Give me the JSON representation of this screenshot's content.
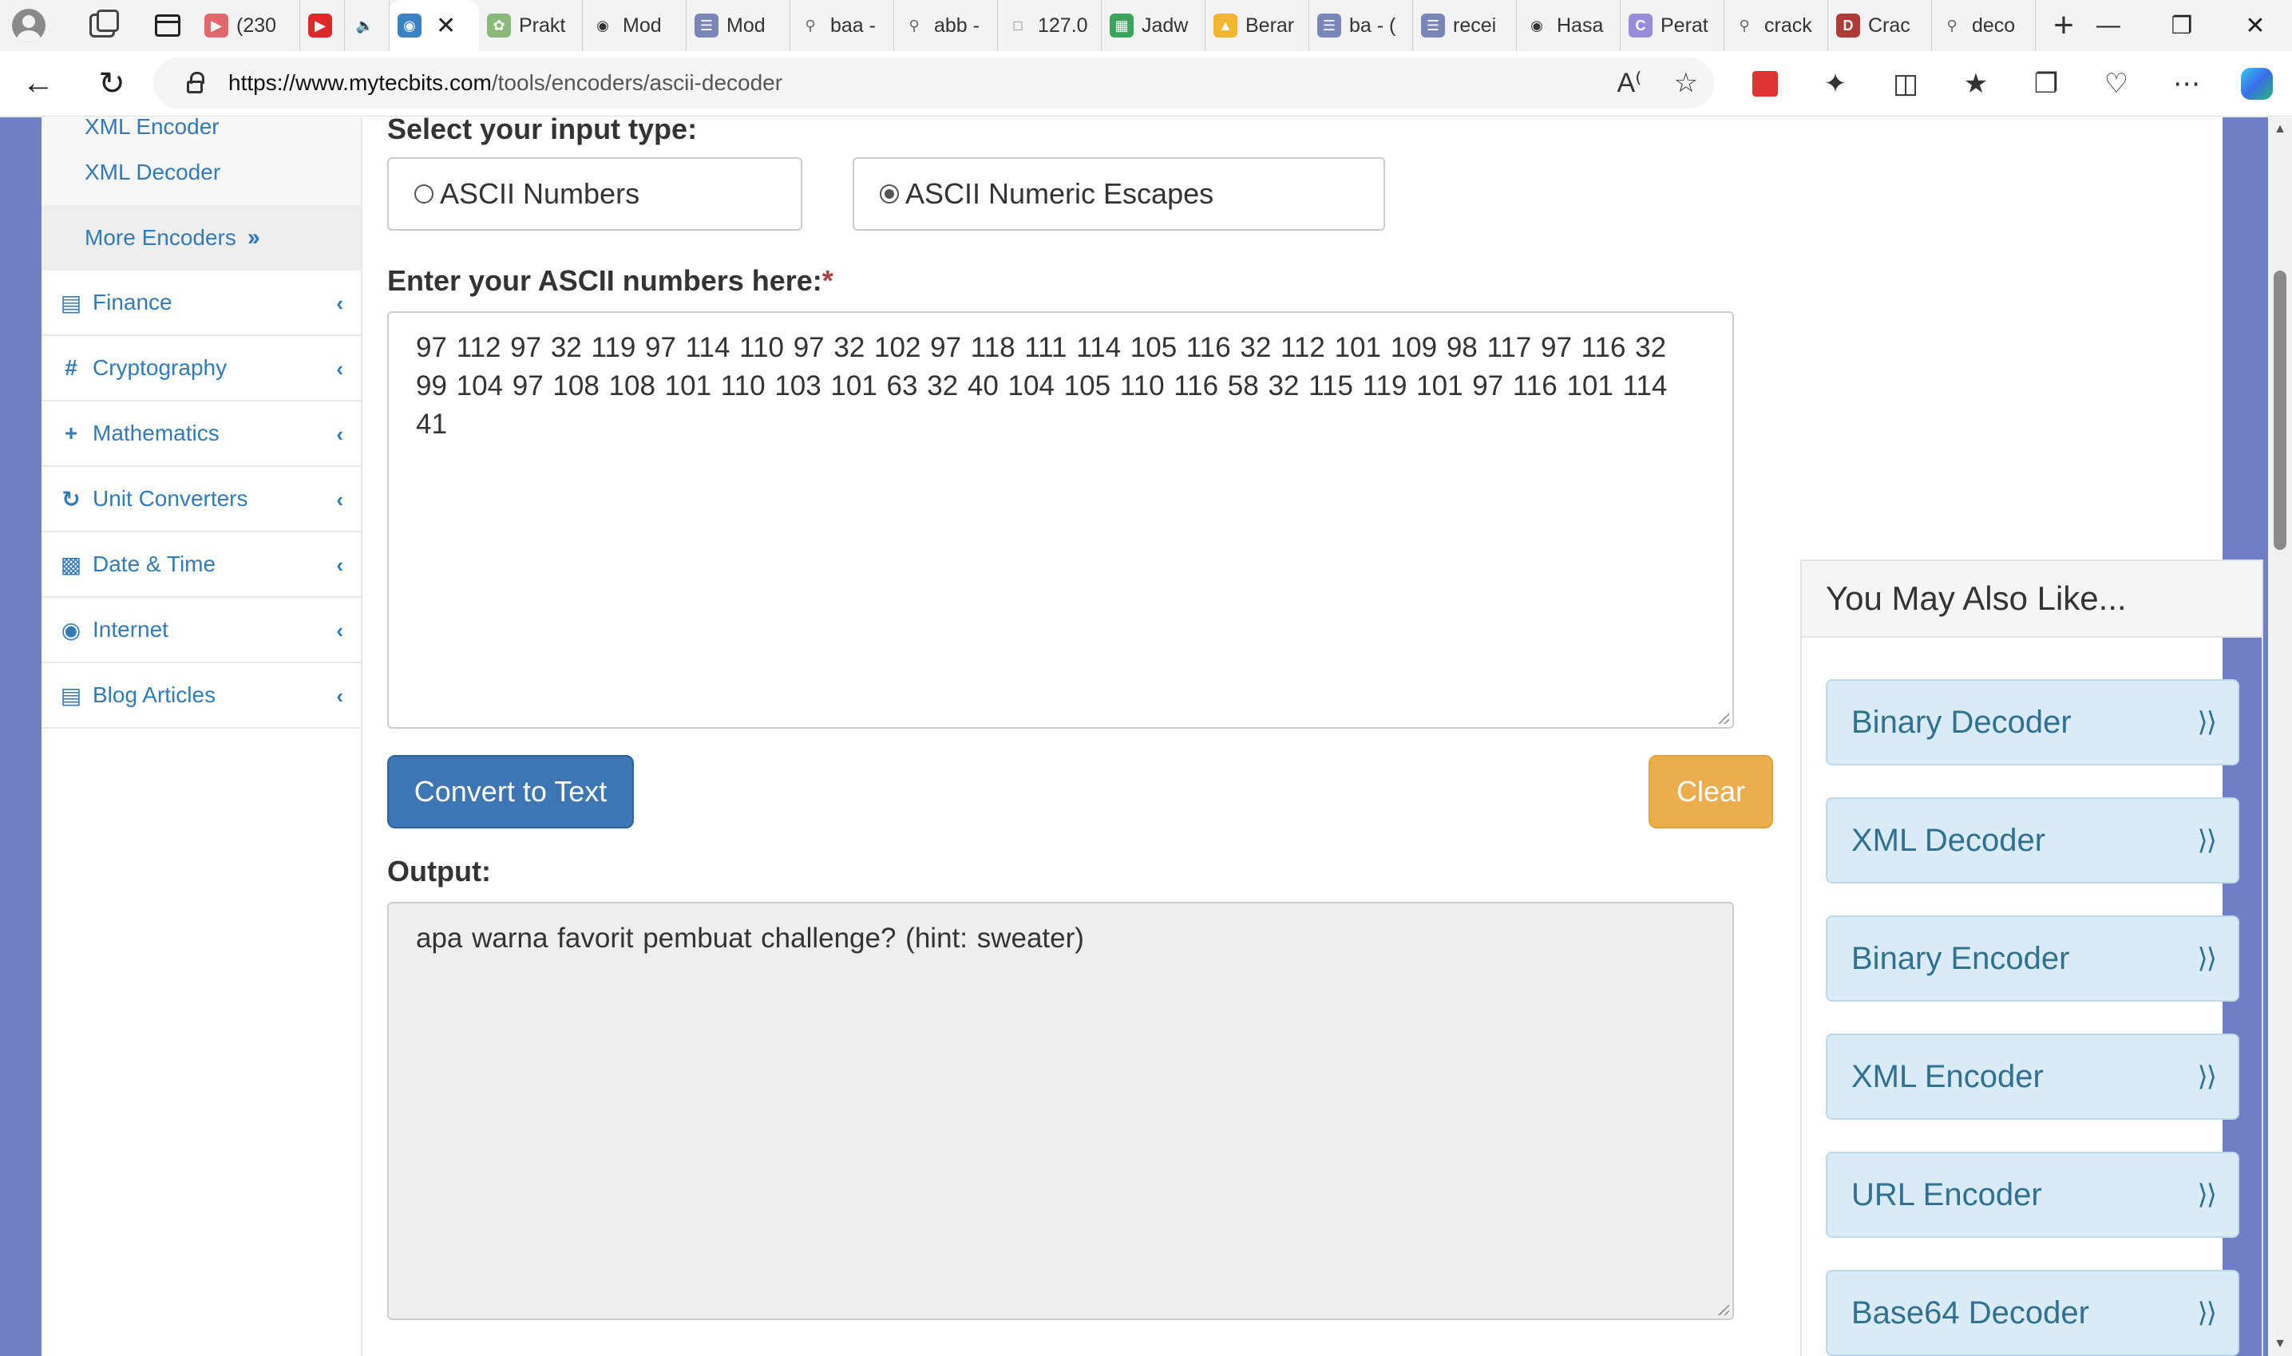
{
  "browser": {
    "tabs": [
      {
        "label": "(230",
        "favicon": "youtube-icon",
        "color": "#e0676d"
      },
      {
        "label": "",
        "favicon": "youtube-icon",
        "color": "#e02828"
      },
      {
        "label": "",
        "favicon": "sound-icon",
        "color": "#333333"
      },
      {
        "label": "",
        "favicon": "globe-icon",
        "color": "#3b82c4",
        "active": true
      },
      {
        "label": "Prakt",
        "favicon": "leaf-icon",
        "color": "#8bb87b"
      },
      {
        "label": "Mod",
        "favicon": "github-icon",
        "color": "#333333"
      },
      {
        "label": "Mod",
        "favicon": "doc-icon",
        "color": "#7a86b8"
      },
      {
        "label": "baa -",
        "favicon": "search-icon",
        "color": "#666666"
      },
      {
        "label": "abb -",
        "favicon": "search-icon",
        "color": "#666666"
      },
      {
        "label": "127.0",
        "favicon": "page-icon",
        "color": "#777777"
      },
      {
        "label": "Jadw",
        "favicon": "sheet-icon",
        "color": "#3aa35c"
      },
      {
        "label": "Berar",
        "favicon": "drive-icon",
        "color": "#f2b632"
      },
      {
        "label": "ba - (",
        "favicon": "doc-icon",
        "color": "#7a86b8"
      },
      {
        "label": "recei",
        "favicon": "doc-icon",
        "color": "#7a86b8"
      },
      {
        "label": "Hasa",
        "favicon": "github-icon",
        "color": "#333333"
      },
      {
        "label": "Perat",
        "favicon": "c-icon",
        "color": "#9a8bd6"
      },
      {
        "label": "crack",
        "favicon": "search-icon",
        "color": "#666666"
      },
      {
        "label": "Crac",
        "favicon": "d-icon",
        "color": "#b03a3a"
      },
      {
        "label": "deco",
        "favicon": "search-icon",
        "color": "#666666"
      }
    ],
    "url_host": "https://www.mytecbits.com",
    "url_path": "/tools/encoders/ascii-decoder"
  },
  "sidebar": {
    "sub_items": [
      "XML Encoder",
      "XML Decoder"
    ],
    "more_label": "More Encoders",
    "items": [
      {
        "label": "Finance",
        "icon": "money-icon"
      },
      {
        "label": "Cryptography",
        "icon": "hash-icon"
      },
      {
        "label": "Mathematics",
        "icon": "plus-icon"
      },
      {
        "label": "Unit Converters",
        "icon": "refresh-icon"
      },
      {
        "label": "Date & Time",
        "icon": "calendar-icon"
      },
      {
        "label": "Internet",
        "icon": "globe-icon"
      },
      {
        "label": "Blog Articles",
        "icon": "book-icon"
      }
    ]
  },
  "main": {
    "input_type_label": "Select your input type:",
    "radio_options": [
      {
        "label": "ASCII Numbers",
        "checked": false
      },
      {
        "label": "ASCII Numeric Escapes",
        "checked": true
      }
    ],
    "input_label": "Enter your ASCII numbers here:",
    "required_mark": "*",
    "input_value": "97 112 97 32 119 97 114 110 97 32 102 97 118 111 114 105 116 32 112 101 109 98 117 97 116 32 99 104 97 108 108 101 110 103 101 63 32 40 104 105 110 116 58 32 115 119 101 97 116 101 114 41",
    "convert_button": "Convert to Text",
    "clear_button": "Clear",
    "output_label": "Output:",
    "output_value": "apa warna favorit pembuat challenge? (hint: sweater)"
  },
  "right_panel": {
    "heading": "You May Also Like...",
    "items": [
      "Binary Decoder",
      "XML Decoder",
      "Binary Encoder",
      "XML Encoder",
      "URL Encoder",
      "Base64 Decoder"
    ]
  },
  "colors": {
    "page_bg": "#6f7fc5",
    "link": "#337ab7",
    "primary_button": "#3e76b3",
    "warning_button": "#ecad4e",
    "card_bg": "#d9ebf7"
  }
}
